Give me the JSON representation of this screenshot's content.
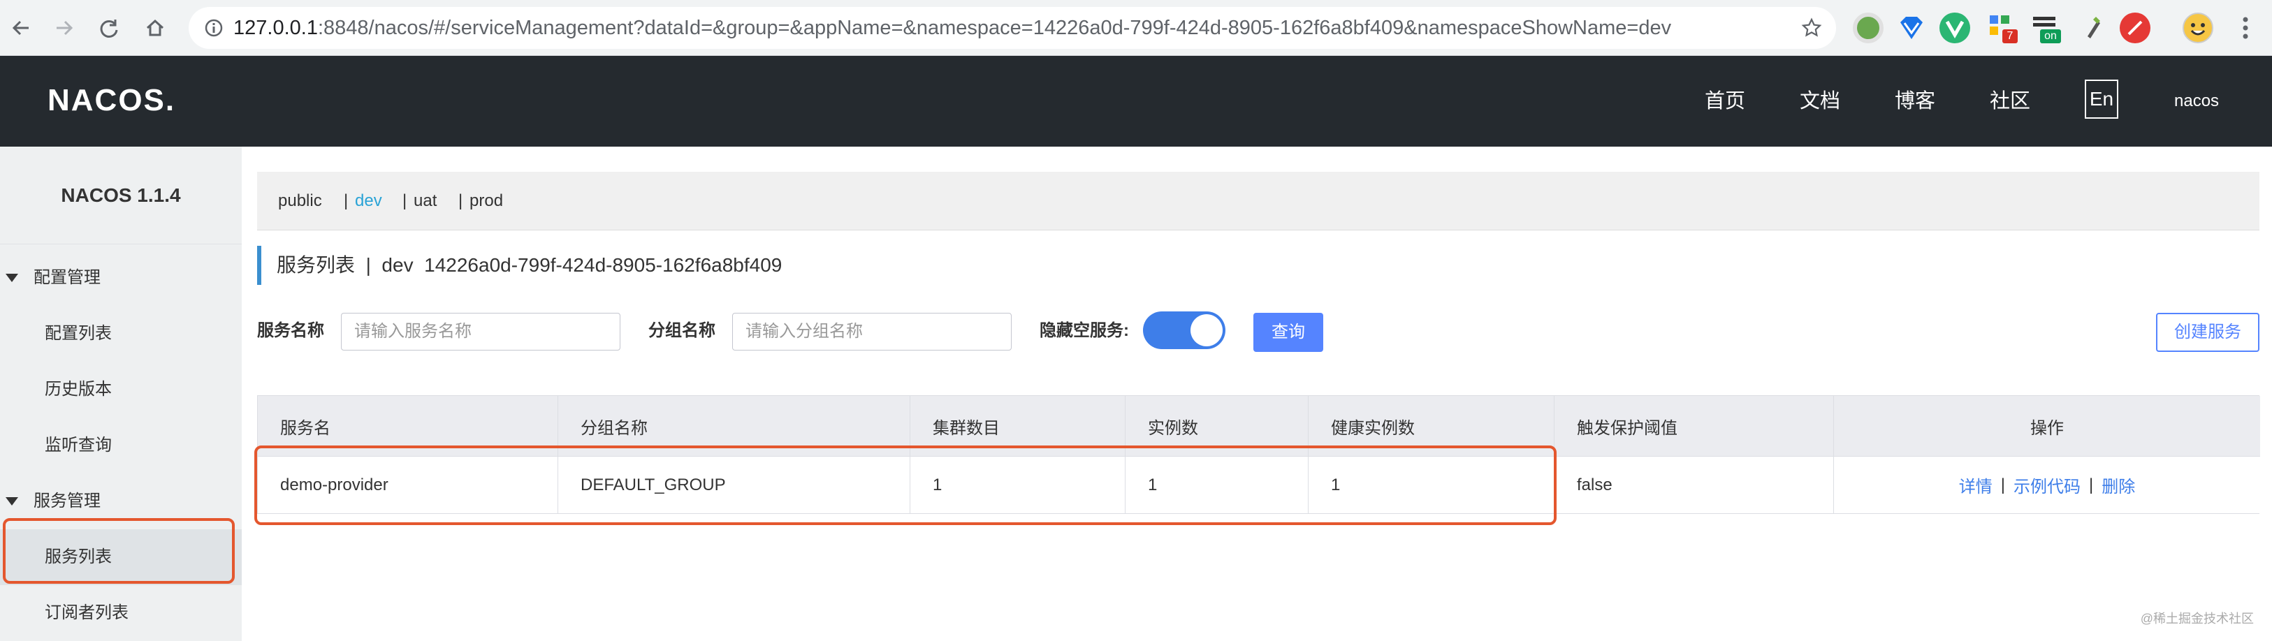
{
  "browser": {
    "url_host": "127.0.0.1",
    "url_rest": ":8848/nacos/#/serviceManagement?dataId=&group=&appName=&namespace=14226a0d-799f-424d-8905-162f6a8bf409&namespaceShowName=dev",
    "extension_badges": [
      "7",
      "on"
    ]
  },
  "header": {
    "logo": "NACOS.",
    "nav": [
      "首页",
      "文档",
      "博客",
      "社区"
    ],
    "lang": "En",
    "user": "nacos"
  },
  "sidebar": {
    "version": "NACOS 1.1.4",
    "groups": [
      {
        "label": "配置管理",
        "items": [
          "配置列表",
          "历史版本",
          "监听查询"
        ]
      },
      {
        "label": "服务管理",
        "items": [
          "服务列表",
          "订阅者列表"
        ]
      }
    ],
    "active_item": "服务列表"
  },
  "namespaces": {
    "items": [
      "public",
      "dev",
      "uat",
      "prod"
    ],
    "separator": "|",
    "active": "dev"
  },
  "title": {
    "text": "服务列表",
    "separator": "|",
    "namespace_name": "dev",
    "namespace_id": "14226a0d-799f-424d-8905-162f6a8bf409"
  },
  "filters": {
    "service_name_label": "服务名称",
    "service_name_placeholder": "请输入服务名称",
    "group_name_label": "分组名称",
    "group_name_placeholder": "请输入分组名称",
    "hide_empty_label": "隐藏空服务:",
    "hide_empty_on": true,
    "query_button": "查询",
    "create_button": "创建服务"
  },
  "table": {
    "columns": [
      "服务名",
      "分组名称",
      "集群数目",
      "实例数",
      "健康实例数",
      "触发保护阈值",
      "操作"
    ],
    "rows": [
      {
        "service": "demo-provider",
        "group": "DEFAULT_GROUP",
        "clusters": "1",
        "instances": "1",
        "healthy": "1",
        "protect": "false",
        "ops": [
          "详情",
          "示例代码",
          "删除"
        ],
        "op_separator": "|"
      }
    ]
  },
  "watermark": "@稀土掘金技术社区",
  "colors": {
    "accent": "#5584ff",
    "highlight": "#e4572e",
    "header_bg": "#252a2f"
  }
}
